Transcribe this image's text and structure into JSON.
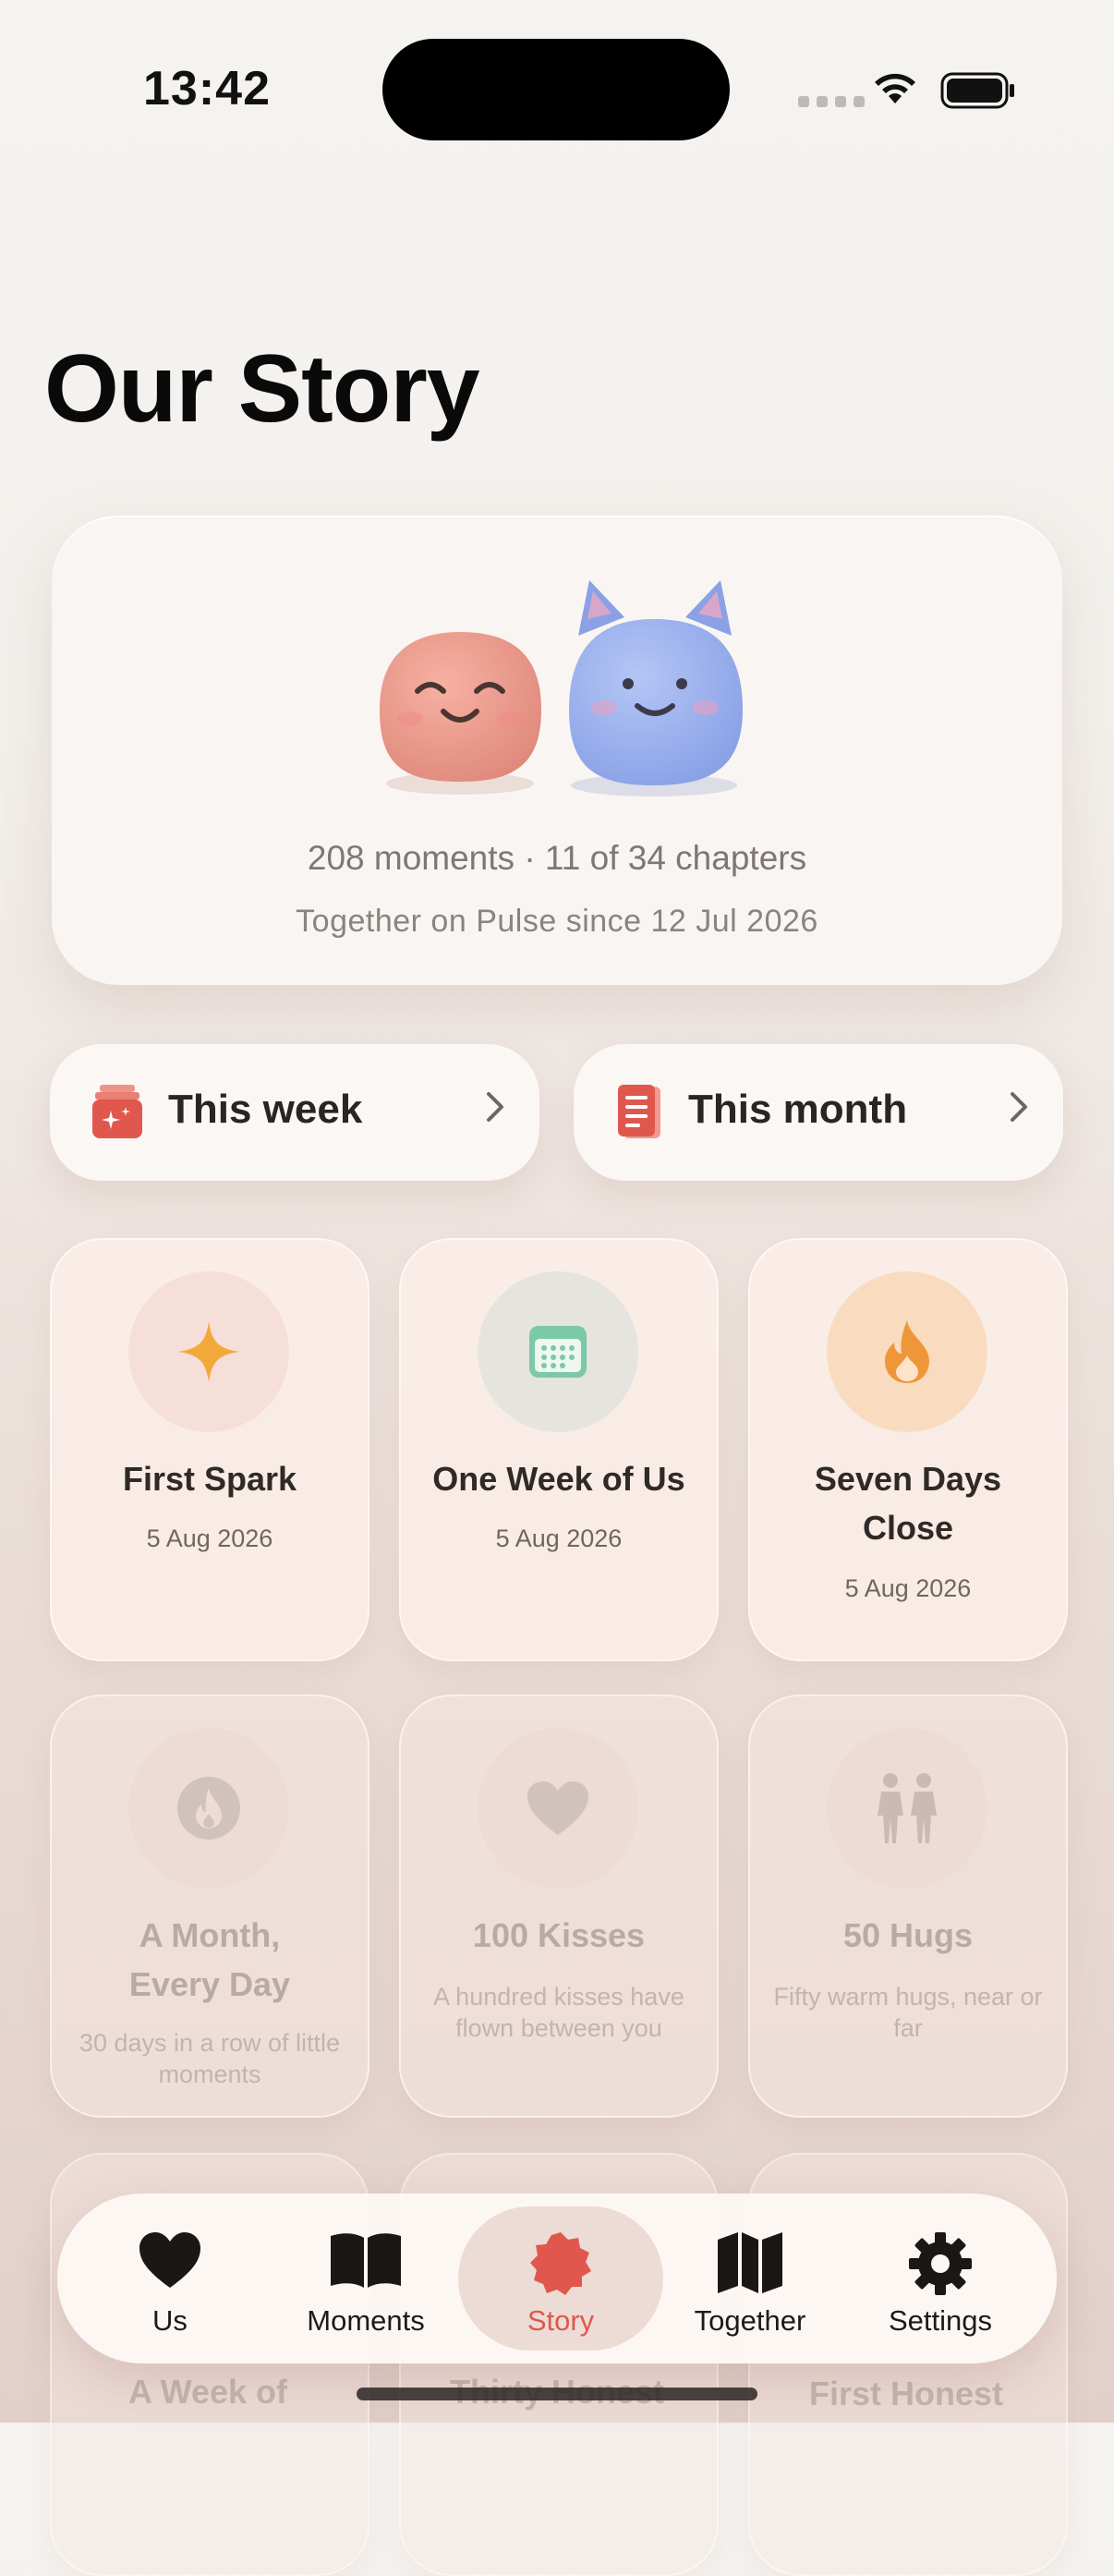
{
  "status": {
    "time": "13:42"
  },
  "page": {
    "title": "Our Story"
  },
  "hero": {
    "stats": "208 moments · 11 of 34 chapters",
    "since": "Together on Pulse since 12 Jul 2026"
  },
  "quick": [
    {
      "label": "This week",
      "icon": "calendar-stack-icon"
    },
    {
      "label": "This month",
      "icon": "journal-icon"
    }
  ],
  "chapters": [
    {
      "title": "First Spark",
      "subtitle": "5 Aug 2026",
      "icon": "sparkle-icon",
      "state": "unlocked",
      "color": "#f2a93b"
    },
    {
      "title": "One Week of Us",
      "subtitle": "5 Aug 2026",
      "icon": "calendar-icon",
      "state": "unlocked",
      "color": "#7cc9a7"
    },
    {
      "title": "Seven Days Close",
      "subtitle": "5 Aug 2026",
      "icon": "flame-icon",
      "state": "unlocked",
      "color": "#f0963a"
    },
    {
      "title": "A Month, Every Day",
      "subtitle": "30 days in a row of little moments",
      "icon": "flame-badge-icon",
      "state": "locked"
    },
    {
      "title": "100 Kisses",
      "subtitle": "A hundred kisses have flown between you",
      "icon": "heart-icon",
      "state": "locked"
    },
    {
      "title": "50 Hugs",
      "subtitle": "Fifty warm hugs, near or far",
      "icon": "two-people-icon",
      "state": "locked"
    }
  ],
  "faded_row": [
    "A Week of",
    "Thirty Honest",
    "First Honest"
  ],
  "tabs": [
    {
      "label": "Us",
      "icon": "heart-icon"
    },
    {
      "label": "Moments",
      "icon": "book-icon"
    },
    {
      "label": "Story",
      "icon": "badge-icon",
      "active": true
    },
    {
      "label": "Together",
      "icon": "map-icon"
    },
    {
      "label": "Settings",
      "icon": "gear-icon"
    }
  ],
  "colors": {
    "accent": "#e0574d",
    "text": "#1a1a1a"
  }
}
